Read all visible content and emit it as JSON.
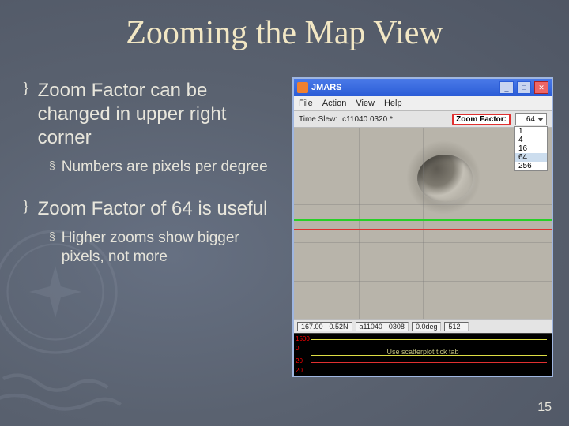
{
  "slide": {
    "title": "Zooming the Map View",
    "page_number": "15"
  },
  "bullets": {
    "b1": "Zoom Factor can be changed in upper right corner",
    "b1_sub": "Numbers are pixels per degree",
    "b2": "Zoom Factor of 64 is useful",
    "b2_sub": "Higher zooms show bigger pixels, not more",
    "l1_mark": "}",
    "l2_mark": "§"
  },
  "app": {
    "title": "JMARS",
    "menu": {
      "file": "File",
      "action": "Action",
      "view": "View",
      "help": "Help"
    },
    "toolbar": {
      "time_label": "Time Slew:",
      "time_value": "c11040 0320 *",
      "zoom_label": "Zoom Factor:",
      "zoom_value": "64"
    },
    "zoom_options": {
      "o1": "1",
      "o2": "4",
      "o3": "16",
      "o4": "64",
      "o5": "256"
    },
    "status": {
      "s1": "167.00 · 0.52N",
      "s2": "a11040 · 0308",
      "s3": "0.0deg",
      "s4": "512 ·"
    },
    "chart": {
      "r1": "1500",
      "r2": "0",
      "r3": "20",
      "r4": "20",
      "label": "Use scatterplot tick tab"
    }
  }
}
